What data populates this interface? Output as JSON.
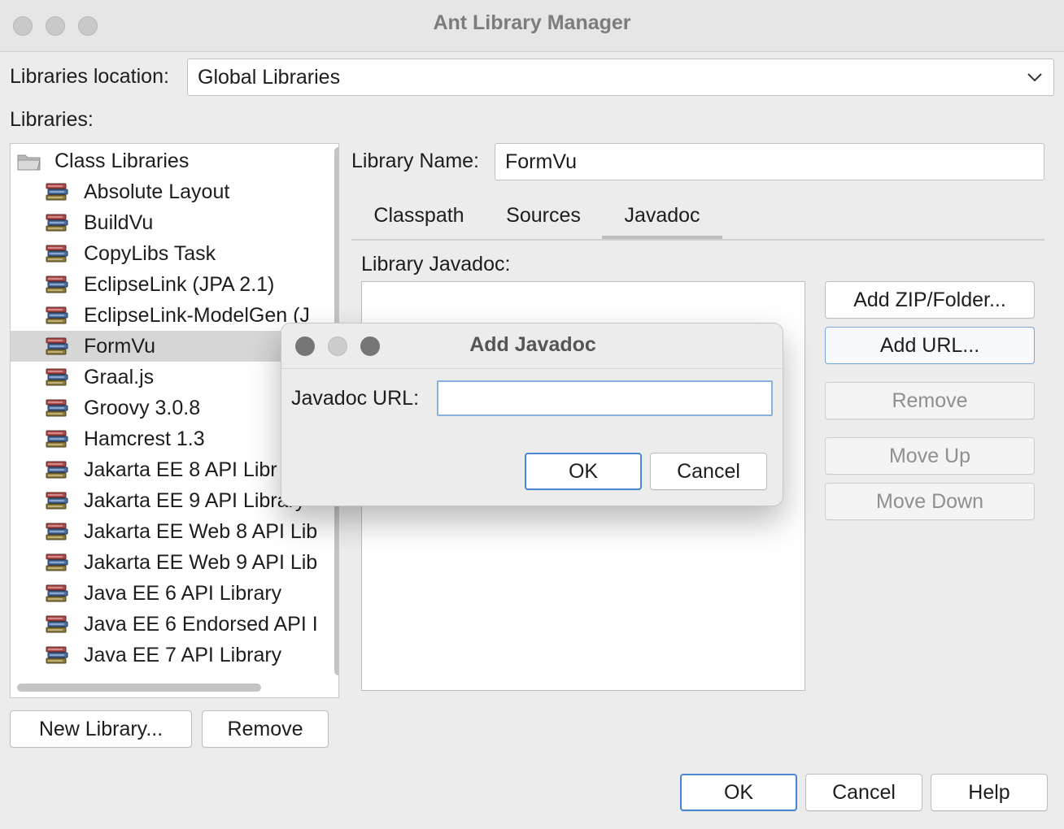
{
  "window": {
    "title": "Ant Library Manager"
  },
  "location": {
    "label": "Libraries location:",
    "value": "Global Libraries"
  },
  "libraries": {
    "label": "Libraries:",
    "root": "Class Libraries",
    "items": [
      "Absolute Layout",
      "BuildVu",
      "CopyLibs Task",
      "EclipseLink (JPA 2.1)",
      "EclipseLink-ModelGen (J",
      "FormVu",
      "Graal.js",
      "Groovy 3.0.8",
      "Hamcrest 1.3",
      "Jakarta EE 8 API Libr",
      "Jakarta EE 9 API Library",
      "Jakarta EE Web 8 API Lib",
      "Jakarta EE Web 9 API Lib",
      "Java EE 6 API Library",
      "Java EE 6 Endorsed API I",
      "Java EE 7 API Library"
    ],
    "selected": "FormVu"
  },
  "library_name": {
    "label": "Library Name:",
    "value": "FormVu"
  },
  "tabs": [
    {
      "label": "Classpath"
    },
    {
      "label": "Sources"
    },
    {
      "label": "Javadoc"
    }
  ],
  "active_tab": "Javadoc",
  "javadoc": {
    "label": "Library Javadoc:"
  },
  "side_buttons": {
    "add_zip": "Add ZIP/Folder...",
    "add_url": "Add URL...",
    "remove": "Remove",
    "move_up": "Move Up",
    "move_down": "Move Down"
  },
  "bottom_left": {
    "new_library": "New Library...",
    "remove": "Remove"
  },
  "footer": {
    "ok": "OK",
    "cancel": "Cancel",
    "help": "Help"
  },
  "dialog": {
    "title": "Add Javadoc",
    "url_label": "Javadoc URL:",
    "url_value": "",
    "ok": "OK",
    "cancel": "Cancel"
  },
  "colors": {
    "accent": "#4a86d4",
    "selection": "#d6d6d6",
    "window_bg": "#ececec"
  }
}
